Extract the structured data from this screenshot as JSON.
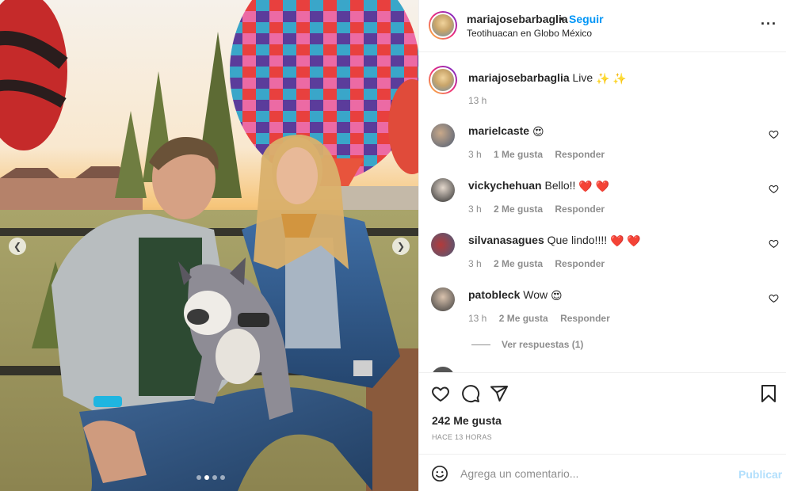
{
  "post": {
    "images": {
      "slide_count": 4,
      "active_slide": 2
    },
    "header": {
      "username": "mariajosebarbaglia",
      "separator": "•",
      "follow_label": "Seguir",
      "location": "Teotihuacan en Globo México",
      "more_icon": "more-horizontal-icon"
    },
    "caption": {
      "username": "mariajosebarbaglia",
      "text": "Live",
      "emojis": "✨ ✨",
      "time": "13 h"
    },
    "comments": [
      {
        "username": "marielcaste",
        "text": "",
        "emoji": "😍",
        "time": "3 h",
        "likes": "1 Me gusta",
        "reply": "Responder"
      },
      {
        "username": "vickychehuan",
        "text": "Bello!!",
        "emoji": "❤️ ❤️",
        "time": "3 h",
        "likes": "2 Me gusta",
        "reply": "Responder"
      },
      {
        "username": "silvanasagues",
        "text": "Que lindo!!!!",
        "emoji": "❤️ ❤️",
        "time": "3 h",
        "likes": "2 Me gusta",
        "reply": "Responder"
      },
      {
        "username": "patobleck",
        "text": "Wow",
        "emoji": "😍",
        "time": "13 h",
        "likes": "2 Me gusta",
        "reply": "Responder",
        "view_replies": "Ver respuestas (1)"
      }
    ],
    "actions": {
      "like_icon": "heart-icon",
      "comment_icon": "comment-icon",
      "share_icon": "send-icon",
      "save_icon": "bookmark-icon"
    },
    "likes_label": "242 Me gusta",
    "time_ago": "HACE 13 HORAS",
    "add_comment": {
      "placeholder": "Agrega un comentario...",
      "post_label": "Publicar",
      "emoji_icon": "smiley-icon"
    },
    "colors": {
      "link": "#0095f6",
      "post_disabled": "#b2dffc",
      "muted": "#8e8e8e",
      "text": "#262626"
    }
  }
}
